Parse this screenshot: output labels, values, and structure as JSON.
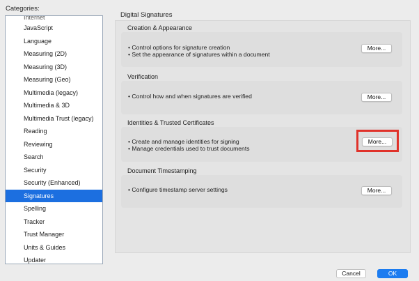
{
  "categories_label": "Categories:",
  "categories": {
    "partial_top": "Internet",
    "items": [
      "JavaScript",
      "Language",
      "Measuring (2D)",
      "Measuring (3D)",
      "Measuring (Geo)",
      "Multimedia (legacy)",
      "Multimedia & 3D",
      "Multimedia Trust (legacy)",
      "Reading",
      "Reviewing",
      "Search",
      "Security",
      "Security (Enhanced)",
      "Signatures",
      "Spelling",
      "Tracker",
      "Trust Manager",
      "Units & Guides",
      "Updater"
    ],
    "selected": "Signatures"
  },
  "panel_title": "Digital Signatures",
  "sections": [
    {
      "heading": "Creation & Appearance",
      "lines": [
        "• Control options for signature creation",
        "• Set the appearance of signatures within a document"
      ],
      "button": "More..."
    },
    {
      "heading": "Verification",
      "lines": [
        "• Control how and when signatures are verified"
      ],
      "button": "More..."
    },
    {
      "heading": "Identities & Trusted Certificates",
      "lines": [
        "• Create and manage identities for signing",
        "• Manage credentials used to trust documents"
      ],
      "button": "More..."
    },
    {
      "heading": "Document Timestamping",
      "lines": [
        "• Configure timestamp server settings"
      ],
      "button": "More..."
    }
  ],
  "footer": {
    "cancel": "Cancel",
    "ok": "OK"
  },
  "colors": {
    "selection": "#1c6fe0",
    "ok_button": "#1c7cf0",
    "highlight": "#e0322a"
  }
}
